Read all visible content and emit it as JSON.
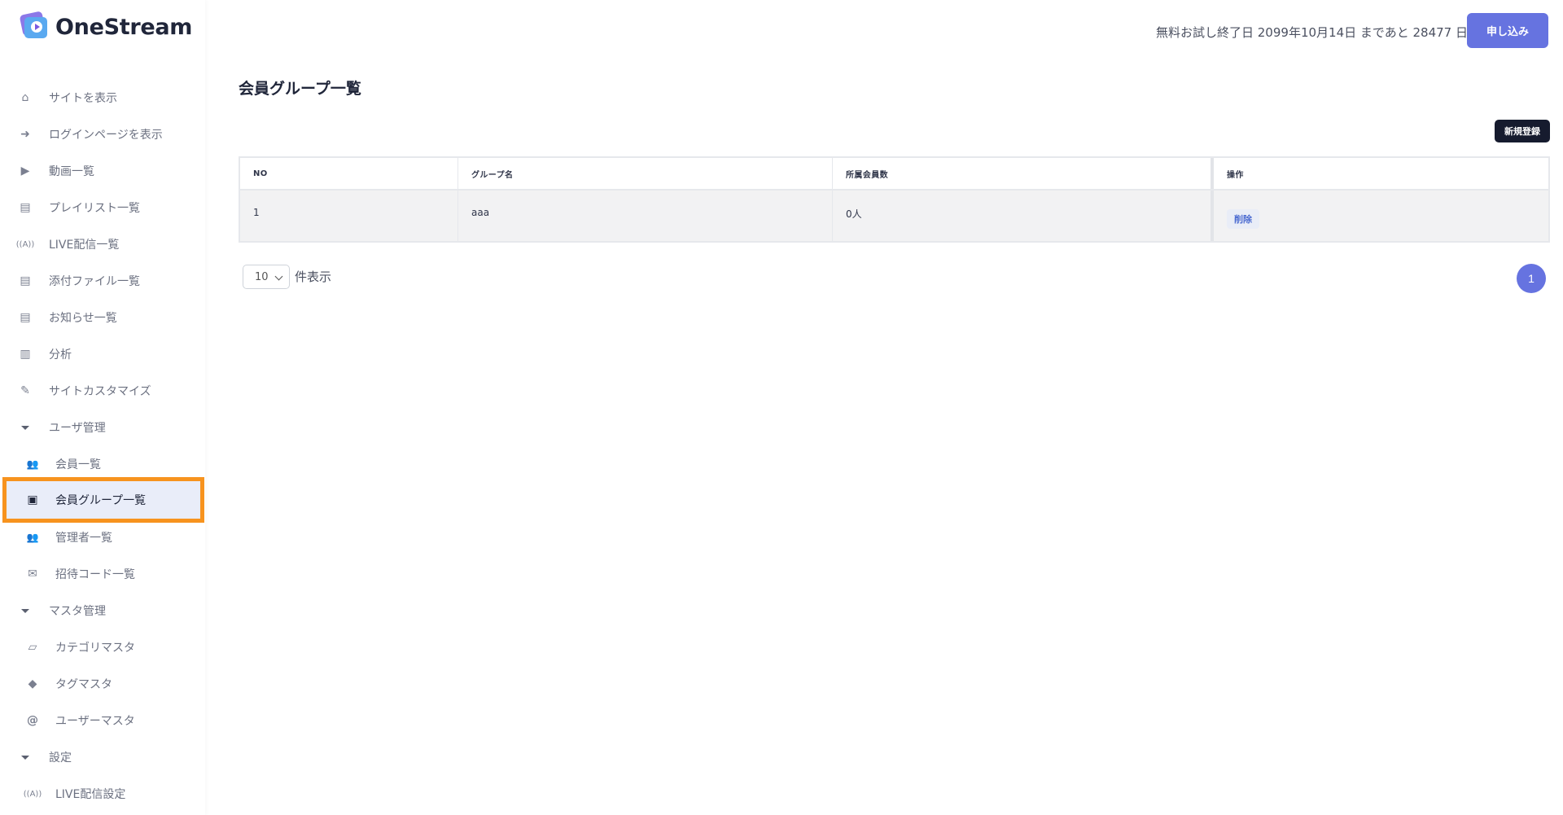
{
  "app": {
    "logo_text": "OneStream"
  },
  "sidebar": {
    "items": [
      {
        "label": "サイトを表示",
        "icon": "home-icon",
        "glyph": "⌂"
      },
      {
        "label": "ログインページを表示",
        "icon": "sign-in-icon",
        "glyph": "➜"
      },
      {
        "label": "動画一覧",
        "icon": "video-icon",
        "glyph": "▶"
      },
      {
        "label": "プレイリスト一覧",
        "icon": "images-icon",
        "glyph": "▤"
      },
      {
        "label": "LIVE配信一覧",
        "icon": "broadcast-icon",
        "glyph": "((A))"
      },
      {
        "label": "添付ファイル一覧",
        "icon": "images-icon",
        "glyph": "▤"
      },
      {
        "label": "お知らせ一覧",
        "icon": "images-icon",
        "glyph": "▤"
      },
      {
        "label": "分析",
        "icon": "bar-chart-icon",
        "glyph": "▥"
      },
      {
        "label": "サイトカスタマイズ",
        "icon": "edit-icon",
        "glyph": "✎"
      },
      {
        "label": "ユーザ管理",
        "icon": "caret-down-icon",
        "glyph": ""
      },
      {
        "label": "会員一覧",
        "icon": "users-icon",
        "glyph": "👥"
      },
      {
        "label": "会員グループ一覧",
        "icon": "group-icon",
        "glyph": "▣"
      },
      {
        "label": "管理者一覧",
        "icon": "users-cog-icon",
        "glyph": "👥"
      },
      {
        "label": "招待コード一覧",
        "icon": "envelope-icon",
        "glyph": "✉"
      },
      {
        "label": "マスタ管理",
        "icon": "caret-down-icon",
        "glyph": ""
      },
      {
        "label": "カテゴリマスタ",
        "icon": "folder-open-icon",
        "glyph": "▱"
      },
      {
        "label": "タグマスタ",
        "icon": "tags-icon",
        "glyph": "◆"
      },
      {
        "label": "ユーザーマスタ",
        "icon": "at-icon",
        "glyph": "@"
      },
      {
        "label": "設定",
        "icon": "caret-down-icon",
        "glyph": ""
      },
      {
        "label": "LIVE配信設定",
        "icon": "broadcast-icon",
        "glyph": "((A))"
      }
    ]
  },
  "header": {
    "trial_text": "無料お試し終了日 2099年10月14日 まであと 28477 日",
    "apply_label": "申し込み"
  },
  "main": {
    "title": "会員グループ一覧",
    "new_label": "新規登録",
    "table": {
      "columns": [
        "NO",
        "グループ名",
        "所属会員数",
        "操作"
      ],
      "rows": [
        {
          "no": "1",
          "name": "aaa",
          "count": "0人",
          "action": "削除"
        }
      ]
    },
    "per_page": {
      "value": "10",
      "label": "件表示"
    },
    "pagination": {
      "current": "1"
    }
  },
  "colors": {
    "accent": "#6673e0",
    "highlight": "#f7931e",
    "dark_button": "#161b2e"
  }
}
